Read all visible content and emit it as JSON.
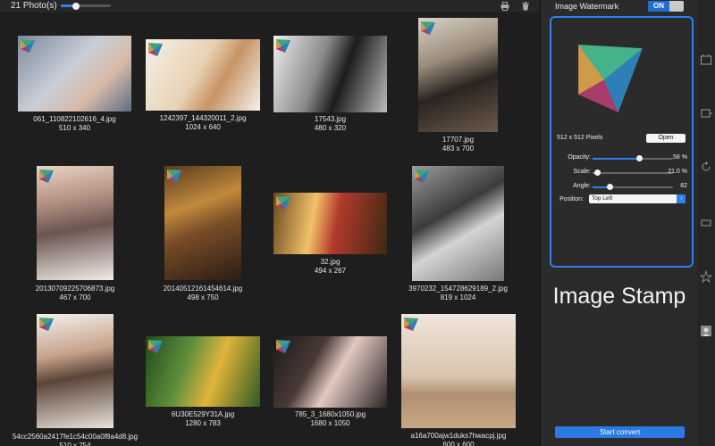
{
  "toolbar": {
    "photo_count": "21 Photo(s)",
    "thumb_size": 0.3,
    "icons": [
      "print-icon",
      "trash-icon"
    ]
  },
  "photos": [
    {
      "name": "061_110822102616_4.jpg",
      "size": "510 x 340"
    },
    {
      "name": "1242397_144320011_2.jpg",
      "size": "1024 x 640"
    },
    {
      "name": "17543.jpg",
      "size": "480 x 320"
    },
    {
      "name": "17707.jpg",
      "size": "483 x 700"
    },
    {
      "name": "20130709225706873.jpg",
      "size": "467 x 700"
    },
    {
      "name": "20140512161454614.jpg",
      "size": "498 x 750"
    },
    {
      "name": "32.jpg",
      "size": "494 x 267"
    },
    {
      "name": "3970232_154728629189_2.jpg",
      "size": "819 x 1024"
    },
    {
      "name": "54cc2560a2417fe1c54c00a0f8a4d8.jpg",
      "size": "510 x 754"
    },
    {
      "name": "6U30E529Y31A.jpg",
      "size": "1280 x 783"
    },
    {
      "name": "785_3_1680x1050.jpg",
      "size": "1680 x 1050"
    },
    {
      "name": "a16a700ajw1duks7hwacpj.jpg",
      "size": "600 x 600"
    }
  ],
  "panel": {
    "title": "Image Watermark",
    "toggle": "ON",
    "pixels": "512 x 512 Pixels",
    "open_label": "Open",
    "opacity": {
      "label": "Opacity:",
      "value": "58 %",
      "level": 0.58
    },
    "scale": {
      "label": "Scale:",
      "value": "21.0 %",
      "level": 0.06
    },
    "angle": {
      "label": "Angle:",
      "value": "82",
      "level": 0.22
    },
    "position": {
      "label": "Position:",
      "value": "Top Left"
    },
    "stamp_title": "Image Stamp",
    "start_label": "Start convert"
  },
  "colors": {
    "accent": "#2f80ed",
    "panel": "#2b2b2b",
    "background": "#1e1e1e"
  },
  "strip_icons": [
    "film-icon",
    "text-box-icon",
    "rotate-icon",
    "crop-icon",
    "star-icon",
    "portrait-icon"
  ]
}
